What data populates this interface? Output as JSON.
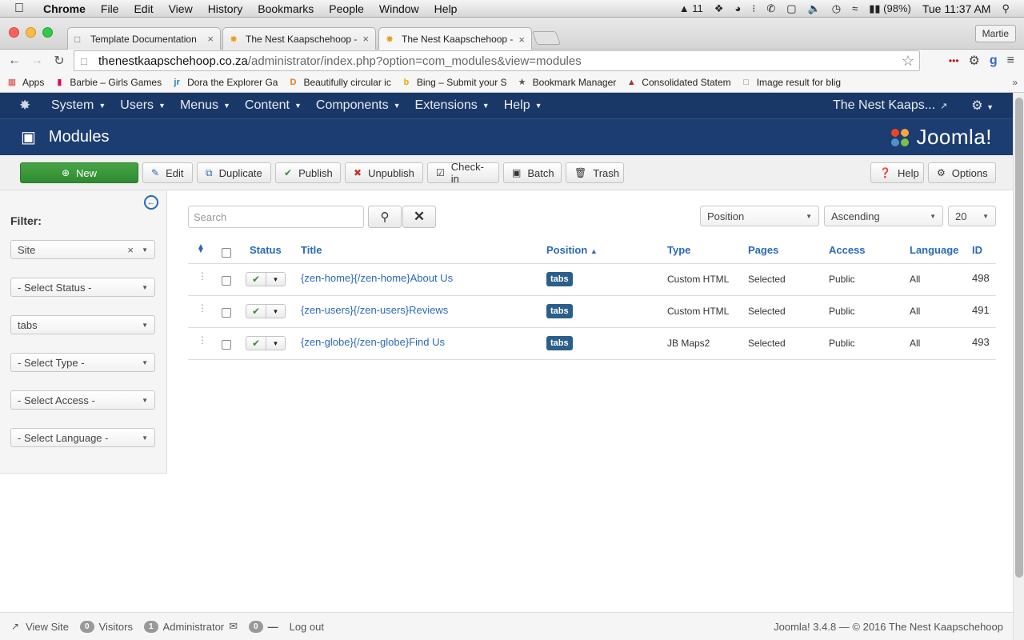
{
  "mac_menubar": {
    "app": "Chrome",
    "menus": [
      "File",
      "Edit",
      "View",
      "History",
      "Bookmarks",
      "People",
      "Window",
      "Help"
    ],
    "adobe_count": "11",
    "battery": "(98%)",
    "clock": "Tue 11:37 AM"
  },
  "browser": {
    "tabs": [
      {
        "label": "Template Documentation"
      },
      {
        "label": "The Nest Kaapschehoop -"
      },
      {
        "label": "The Nest Kaapschehoop -"
      }
    ],
    "profile": "Martie",
    "url_host": "thenestkaapschehoop.co.za",
    "url_path": "/administrator/index.php?option=com_modules&view=modules",
    "bookmarks": [
      {
        "label": "Apps"
      },
      {
        "label": "Barbie – Girls Games"
      },
      {
        "label": "Dora the Explorer Ga"
      },
      {
        "label": "Beautifully circular ic"
      },
      {
        "label": "Bing – Submit your S"
      },
      {
        "label": "Bookmark Manager"
      },
      {
        "label": "Consolidated Statem"
      },
      {
        "label": "Image result for blig"
      }
    ]
  },
  "admin_nav": {
    "menus": [
      "System",
      "Users",
      "Menus",
      "Content",
      "Components",
      "Extensions",
      "Help"
    ],
    "site_name": "The Nest Kaaps..."
  },
  "header": {
    "title": "Modules",
    "brand": "Joomla!"
  },
  "toolbar": {
    "new": "New",
    "edit": "Edit",
    "duplicate": "Duplicate",
    "publish": "Publish",
    "unpublish": "Unpublish",
    "checkin": "Check-in",
    "batch": "Batch",
    "trash": "Trash",
    "help": "Help",
    "options": "Options"
  },
  "sidebar": {
    "filter_label": "Filter:",
    "client": "Site",
    "status": "- Select Status -",
    "position": "tabs",
    "type": "- Select Type -",
    "access": "- Select Access -",
    "language": "- Select Language -"
  },
  "list": {
    "search_placeholder": "Search",
    "order_by": "Position",
    "direction": "Ascending",
    "limit": "20",
    "columns": {
      "status": "Status",
      "title": "Title",
      "position": "Position",
      "type": "Type",
      "pages": "Pages",
      "access": "Access",
      "language": "Language",
      "id": "ID"
    },
    "rows": [
      {
        "title": "{zen-home}{/zen-home}About Us",
        "position": "tabs",
        "type": "Custom HTML",
        "pages": "Selected",
        "access": "Public",
        "language": "All",
        "id": "498"
      },
      {
        "title": "{zen-users}{/zen-users}Reviews",
        "position": "tabs",
        "type": "Custom HTML",
        "pages": "Selected",
        "access": "Public",
        "language": "All",
        "id": "491"
      },
      {
        "title": "{zen-globe}{/zen-globe}Find Us",
        "position": "tabs",
        "type": "JB Maps2",
        "pages": "Selected",
        "access": "Public",
        "language": "All",
        "id": "493"
      }
    ]
  },
  "footer": {
    "view_site": "View Site",
    "visitors_count": "0",
    "visitors": "Visitors",
    "admin_count": "1",
    "admin": "Administrator",
    "messages_count": "0",
    "logout": "Log out",
    "copyright": "Joomla! 3.4.8  —  © 2016 The Nest Kaapschehoop"
  }
}
